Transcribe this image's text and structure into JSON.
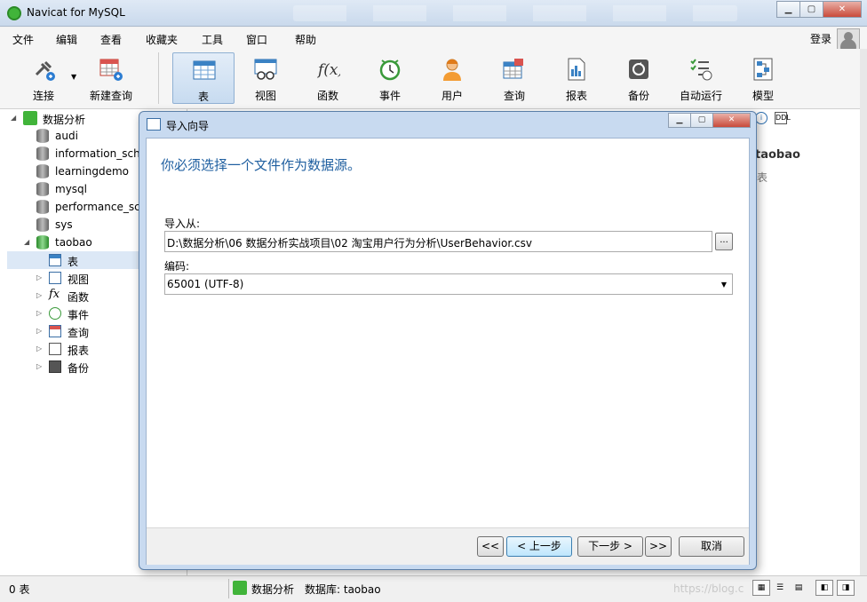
{
  "window": {
    "title": "Navicat for MySQL"
  },
  "menu": [
    "文件",
    "编辑",
    "查看",
    "收藏夹",
    "工具",
    "窗口",
    "帮助"
  ],
  "login": "登录",
  "toolbar": {
    "connect": "连接",
    "new_query": "新建查询",
    "table": "表",
    "view": "视图",
    "function": "函数",
    "event": "事件",
    "user": "用户",
    "query": "查询",
    "report": "报表",
    "backup": "备份",
    "autorun": "自动运行",
    "model": "模型"
  },
  "tree": {
    "connection": "数据分析",
    "databases": [
      "audi",
      "information_sche",
      "learningdemo",
      "mysql",
      "performance_scl",
      "sys",
      "taobao"
    ],
    "objects": [
      "表",
      "视图",
      "函数",
      "事件",
      "查询",
      "报表",
      "备份"
    ]
  },
  "right_panel": {
    "db_name": "taobao",
    "type": "表",
    "ddl": "DDL"
  },
  "dialog": {
    "title": "导入向导",
    "heading": "你必须选择一个文件作为数据源。",
    "import_from_label": "导入从:",
    "import_path": "D:\\数据分析\\06 数据分析实战项目\\02 淘宝用户行为分析\\UserBehavior.csv",
    "browse": "...",
    "encoding_label": "编码:",
    "encoding_value": "65001 (UTF-8)",
    "buttons": {
      "first": "<<",
      "prev": "< 上一步",
      "next": "下一步 >",
      "last": ">>",
      "cancel": "取消"
    }
  },
  "status": {
    "count": "0 表",
    "connection": "数据分析",
    "database": "数据库: taobao",
    "watermark": "https://blog.c"
  }
}
